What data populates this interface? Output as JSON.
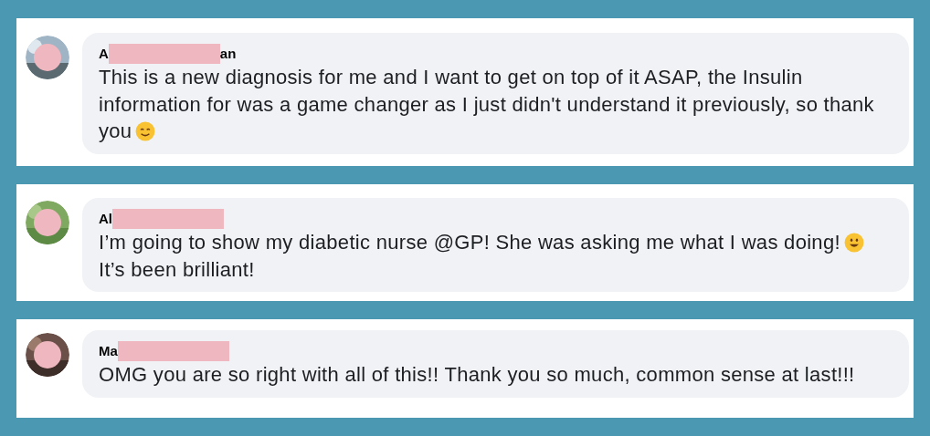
{
  "comments": [
    {
      "kind": "smiling",
      "name_start": "A",
      "name_end": "an",
      "text": "This is a new diagnosis for me and I want to get on top of it ASAP, the Insulin information for was a game changer as I just didn't understand it previously, so thank you"
    },
    {
      "kind": "grinning",
      "name_start": "Al",
      "text": "I’m going to show my diabetic nurse @GP! She was asking me what I was doing!",
      "text_after": "It’s been brilliant!"
    },
    {
      "kind": "plain",
      "name_start": "Ma",
      "text": "OMG you are so right with all of this!! Thank you so much, common sense at last!!!"
    }
  ]
}
